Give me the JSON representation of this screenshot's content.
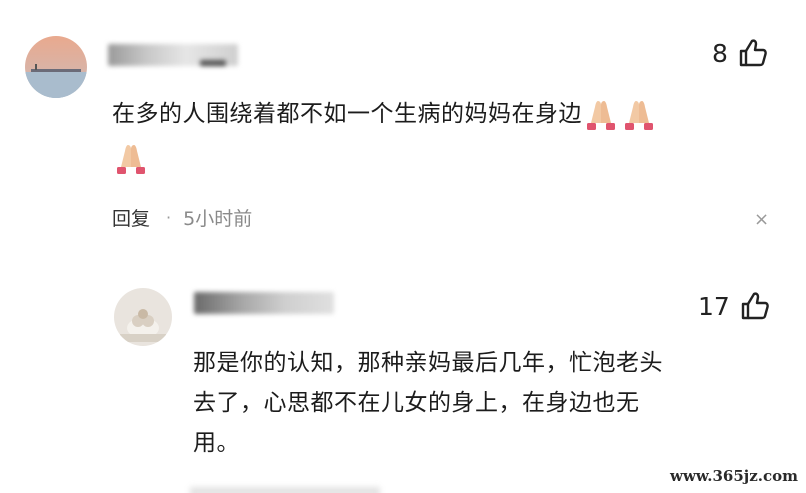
{
  "comments": [
    {
      "username": "",
      "likes": "8",
      "text_line1": "在多的人围绕着都不如一个生病的妈妈在身边",
      "reply_label": "回复",
      "separator": "·",
      "time": "5小时前",
      "close_glyph": "×"
    },
    {
      "username": "",
      "likes": "17",
      "text_line1": "那是你的认知，那种亲妈最后几年，忙泡老头",
      "text_line2": "去了，心思都不在儿女的身上，在身边也无",
      "text_line3": "用。"
    }
  ],
  "watermark": "www.365jz.com",
  "icons": {
    "like": "thumbs-up-icon",
    "emoji": "folded-hands-icon",
    "close": "close-icon"
  },
  "colors": {
    "background": "#ffffff",
    "text": "#1c1c1c",
    "meta_gray": "#8a8a8a",
    "emoji_skin": "#f2c9a4",
    "emoji_cuff": "#e0546e"
  }
}
